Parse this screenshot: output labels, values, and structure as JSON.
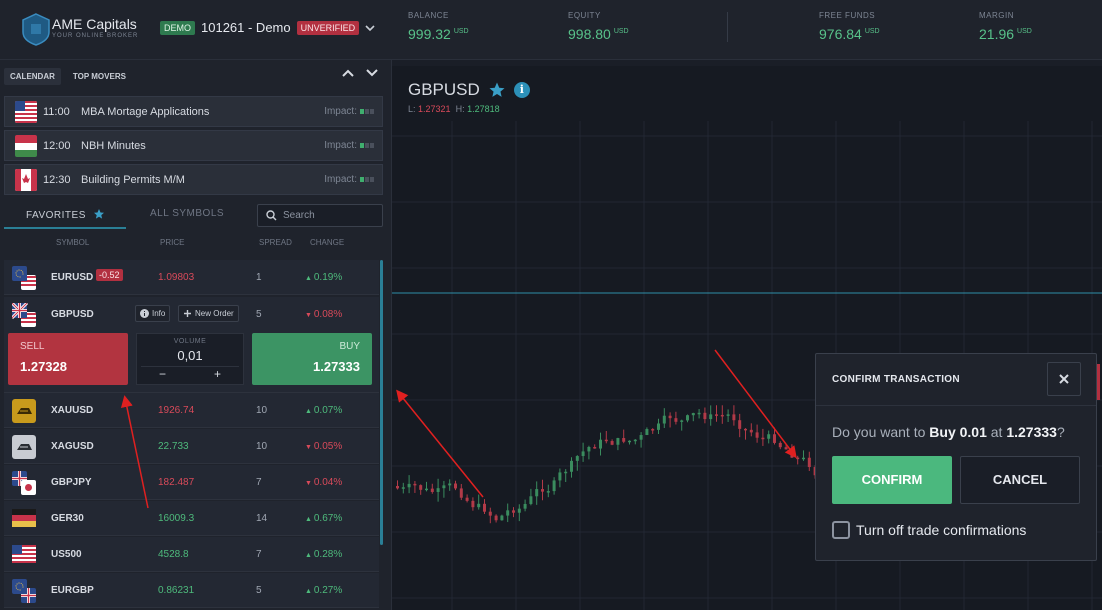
{
  "header": {
    "brand": "AME Capitals",
    "tagline": "YOUR ONLINE BROKER",
    "demo_badge": "DEMO",
    "account": "101261 - Demo",
    "unverified_badge": "UNVERIFIED",
    "stats": [
      {
        "label": "BALANCE",
        "value": "999.32",
        "unit": "USD"
      },
      {
        "label": "EQUITY",
        "value": "998.80",
        "unit": "USD"
      },
      {
        "label": "FREE FUNDS",
        "value": "976.84",
        "unit": "USD"
      },
      {
        "label": "MARGIN",
        "value": "21.96",
        "unit": "USD"
      }
    ]
  },
  "calendar": {
    "tabs": [
      "CALENDAR",
      "TOP MOVERS"
    ],
    "events": [
      {
        "flag": "us-flag-icon",
        "time": "11:00",
        "title": "MBA Mortage Applications",
        "impact_label": "Impact:"
      },
      {
        "flag": "hungary-flag-icon",
        "time": "12:00",
        "title": "NBH Minutes",
        "impact_label": "Impact:"
      },
      {
        "flag": "canada-flag-icon",
        "time": "12:30",
        "title": "Building Permits M/M",
        "impact_label": "Impact:"
      }
    ]
  },
  "symbols": {
    "tab_favorites": "FAVORITES",
    "tab_all": "ALL SYMBOLS",
    "search_placeholder": "Search",
    "columns": [
      "SYMBOL",
      "PRICE",
      "SPREAD",
      "CHANGE"
    ],
    "rows": [
      {
        "icon": "eur-usd-flags-icon",
        "symbol": "EURUSD",
        "badge": "-0.52",
        "price": "1.09803",
        "spread": "1",
        "change": "0.19%",
        "dir": "up"
      },
      {
        "icon": "gbp-usd-flags-icon",
        "symbol": "GBPUSD",
        "price": "",
        "spread": "5",
        "change": "0.08%",
        "dir": "down"
      },
      {
        "icon": "gold-bar-icon",
        "symbol": "XAUUSD",
        "price": "1926.74",
        "spread": "10",
        "change": "0.07%",
        "dir": "up"
      },
      {
        "icon": "silver-bar-icon",
        "symbol": "XAGUSD",
        "price": "22.733",
        "spread": "10",
        "change": "0.05%",
        "dir": "down"
      },
      {
        "icon": "gbp-jpy-flags-icon",
        "symbol": "GBPJPY",
        "price": "182.487",
        "spread": "7",
        "change": "0.04%",
        "dir": "down"
      },
      {
        "icon": "germany-flag-icon",
        "symbol": "GER30",
        "price": "16009.3",
        "spread": "14",
        "change": "0.67%",
        "dir": "up"
      },
      {
        "icon": "us-flag-icon",
        "symbol": "US500",
        "price": "4528.8",
        "spread": "7",
        "change": "0.28%",
        "dir": "up"
      },
      {
        "icon": "eur-gbp-flags-icon",
        "symbol": "EURGBP",
        "price": "0.86231",
        "spread": "5",
        "change": "0.27%",
        "dir": "up"
      }
    ],
    "expanded": {
      "info_label": "Info",
      "new_order_label": "New Order",
      "sell_label": "SELL",
      "sell_price": "1.27328",
      "buy_label": "BUY",
      "buy_price": "1.27333",
      "volume_label": "VOLUME",
      "volume": "0,01",
      "minus": "−",
      "plus": "+"
    }
  },
  "chart": {
    "symbol": "GBPUSD",
    "low_label": "L:",
    "low": "1.27321",
    "high_label": "H:",
    "high": "1.27818"
  },
  "dialog": {
    "title": "CONFIRM TRANSACTION",
    "q_prefix": "Do you want to",
    "q_action": "Buy 0.01",
    "q_at": "at",
    "q_price": "1.27333",
    "q_suffix": "?",
    "confirm": "CONFIRM",
    "cancel": "CANCEL",
    "checkbox_label": "Turn off trade confirmations"
  },
  "colors": {
    "green": "#4eba7c",
    "red": "#d84a5a",
    "accent": "#2a7f96"
  }
}
